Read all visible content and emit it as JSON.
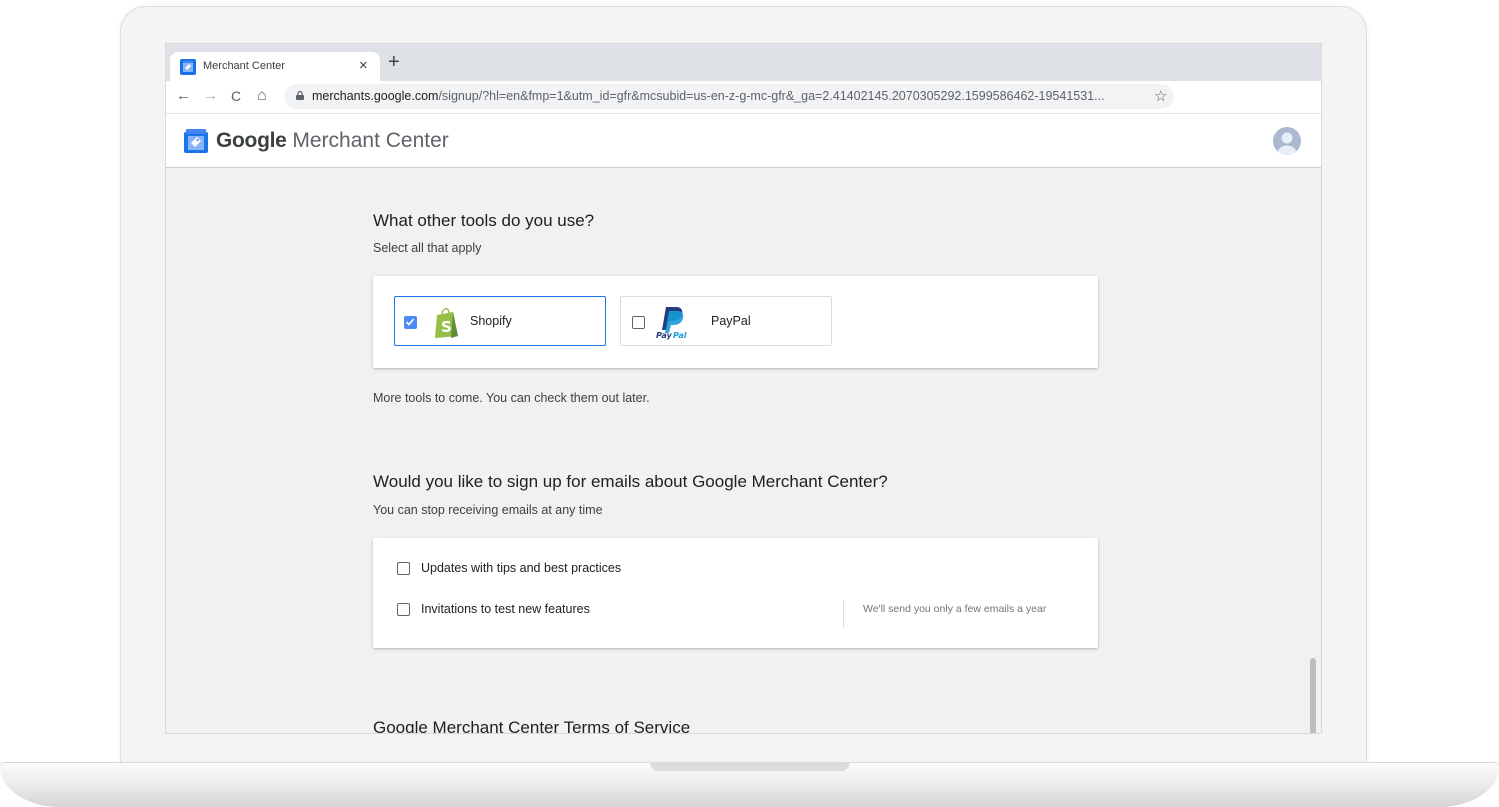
{
  "browser": {
    "tab_title": "Merchant Center",
    "tab_close": "×",
    "new_tab": "+",
    "url_domain": "merchants.google.com",
    "url_path": "/signup/?hl=en&fmp=1&utm_id=gfr&mcsubid=us-en-z-g-mc-gfr&_ga=2.41402145.2070305292.1599586462-19541531...",
    "nav": {
      "back": "←",
      "forward": "→",
      "reload": "C",
      "home": "⌂",
      "star": "☆"
    }
  },
  "app": {
    "brand_google": "Google",
    "brand_product": "Merchant Center"
  },
  "tools_section": {
    "title": "What other tools do you use?",
    "subtitle": "Select all that apply",
    "options": [
      {
        "label": "Shopify",
        "checked": true
      },
      {
        "label": "PayPal",
        "checked": false
      }
    ],
    "footnote": "More tools to come. You can check them out later."
  },
  "email_section": {
    "title": "Would you like to sign up for emails about Google Merchant Center?",
    "subtitle": "You can stop receiving emails at any time",
    "options": [
      {
        "label": "Updates with tips and best practices",
        "checked": false
      },
      {
        "label": "Invitations to test new features",
        "checked": false
      }
    ],
    "note": "We'll send you only a few emails a year"
  },
  "tos_section": {
    "title": "Google Merchant Center Terms of Service"
  },
  "colors": {
    "accent": "#1a73e8",
    "checkbox_checked": "#4c8bf5",
    "shopify_green": "#95bf47",
    "paypal_dark": "#253b80",
    "paypal_light": "#179bd7"
  }
}
